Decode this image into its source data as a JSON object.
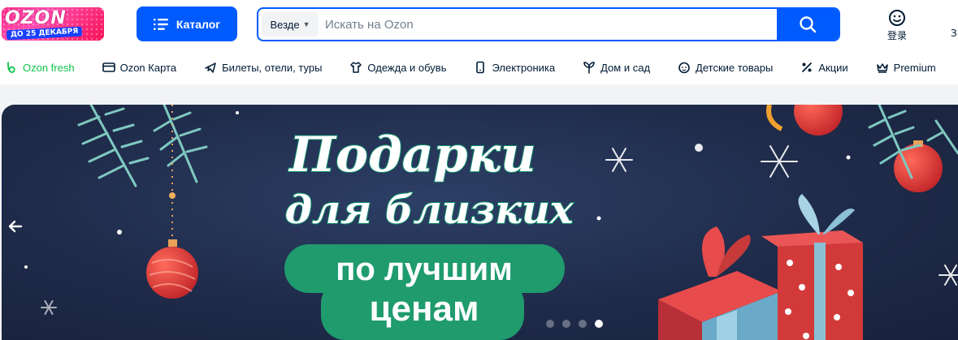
{
  "logo": {
    "word": "OZON",
    "promo": "ДО 25 ДЕКАБРЯ"
  },
  "header": {
    "catalog_label": "Каталог",
    "search": {
      "scope": "Везде",
      "placeholder": "Искать на Ozon"
    },
    "login_label": "登录",
    "cut_label": "З"
  },
  "nav": {
    "items": [
      {
        "label": "Ozon fresh",
        "icon": "fresh-icon",
        "color": "#10c44c"
      },
      {
        "label": "Ozon Карта",
        "icon": "card-icon"
      },
      {
        "label": "Билеты, отели, туры",
        "icon": "plane-icon"
      },
      {
        "label": "Одежда и обувь",
        "icon": "clothes-icon"
      },
      {
        "label": "Электроника",
        "icon": "phone-icon"
      },
      {
        "label": "Дом и сад",
        "icon": "plant-icon"
      },
      {
        "label": "Детские товары",
        "icon": "baby-icon"
      },
      {
        "label": "Акции",
        "icon": "percent-icon"
      },
      {
        "label": "Premium",
        "icon": "crown-icon"
      }
    ]
  },
  "banner": {
    "title_line1": "Подарки",
    "title_line2": "для близких",
    "pill_line1": "по лучшим",
    "pill_line2": "ценам",
    "slides": 4,
    "active_slide": 4
  },
  "colors": {
    "brand": "#005bff",
    "fresh": "#10c44c",
    "banner_bg": "#1f2b4a",
    "pill": "#1f9b6e"
  }
}
